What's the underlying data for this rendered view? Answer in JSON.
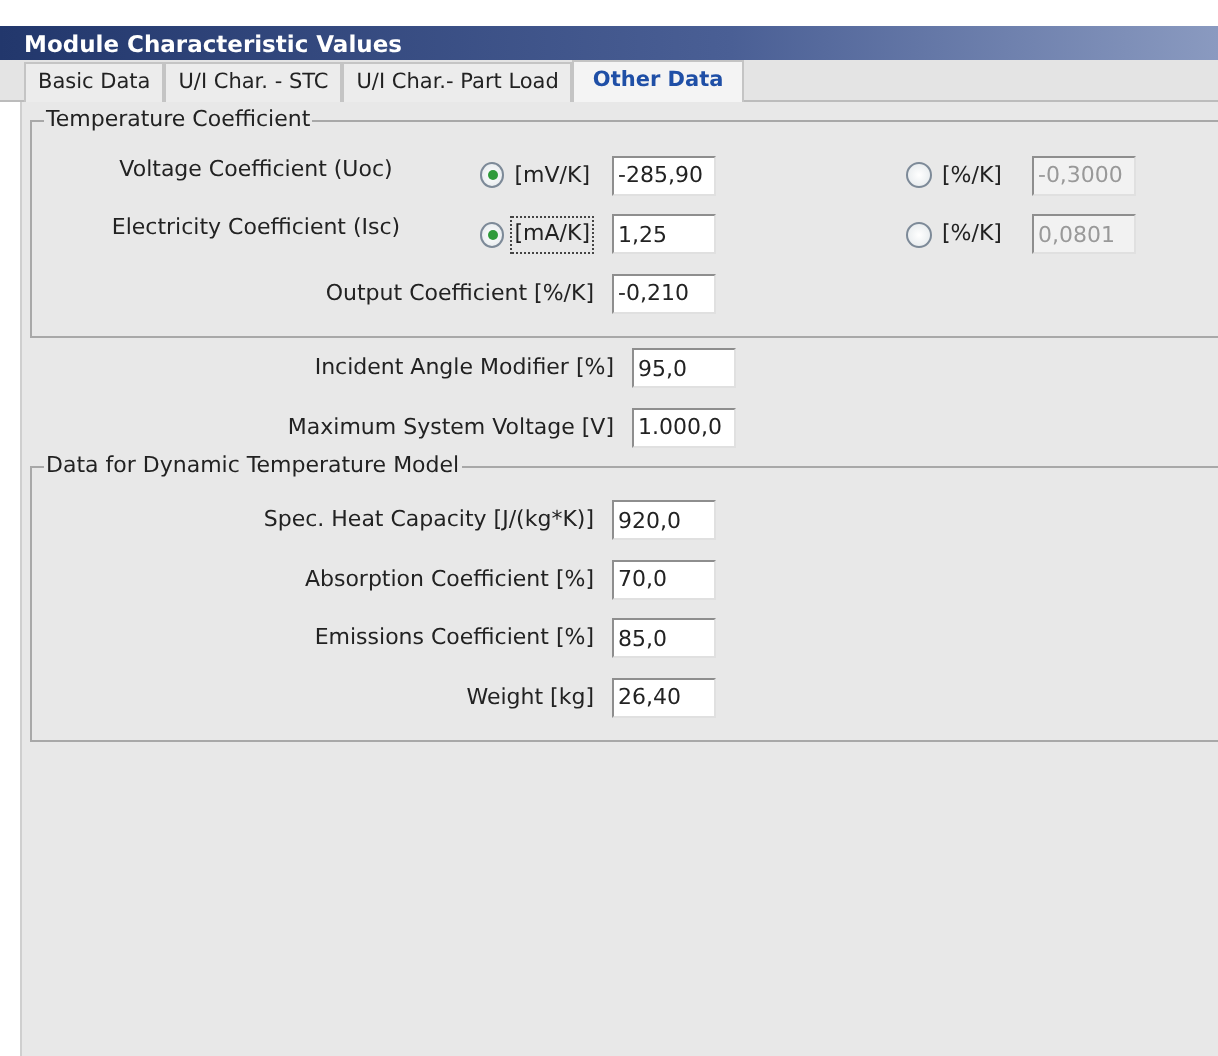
{
  "window": {
    "title": "Module Characteristic Values"
  },
  "tabs": [
    {
      "label": "Basic Data",
      "selected": false
    },
    {
      "label": "U/I Char. - STC",
      "selected": false
    },
    {
      "label": "U/I Char.- Part Load",
      "selected": false
    },
    {
      "label": "Other Data",
      "selected": true
    }
  ],
  "temperature_coefficient": {
    "title": "Temperature Coefficient",
    "rows": [
      {
        "kind": "choice",
        "label": "Voltage Coefficient (Uoc)",
        "options": [
          {
            "unit": "[mV/K]",
            "selected": true,
            "focused": false,
            "value": "-285,90"
          },
          {
            "unit": "[%/K]",
            "selected": false,
            "focused": false,
            "value": "-0,3000"
          }
        ]
      },
      {
        "kind": "choice",
        "label": "Electricity Coefficient (Isc)",
        "options": [
          {
            "unit": "[mA/K]",
            "selected": true,
            "focused": true,
            "value": "1,25"
          },
          {
            "unit": "[%/K]",
            "selected": false,
            "focused": false,
            "value": "0,0801"
          }
        ]
      },
      {
        "kind": "plain",
        "label": "Output Coefficient [%/K]",
        "value": "-0,210"
      }
    ]
  },
  "fields": [
    {
      "label": "Incident Angle Modifier [%]",
      "value": "95,0"
    },
    {
      "label": "Maximum System Voltage [V]",
      "value": "1.000,0"
    }
  ],
  "dynamic_temperature_model": {
    "title": "Data for Dynamic Temperature Model",
    "rows": [
      {
        "label": "Spec. Heat Capacity [J/(kg*K)]",
        "value": "920,0"
      },
      {
        "label": "Absorption Coefficient [%]",
        "value": "70,0"
      },
      {
        "label": "Emissions Coefficient [%]",
        "value": "85,0"
      },
      {
        "label": "Weight [kg]",
        "value": "26,40"
      }
    ]
  }
}
